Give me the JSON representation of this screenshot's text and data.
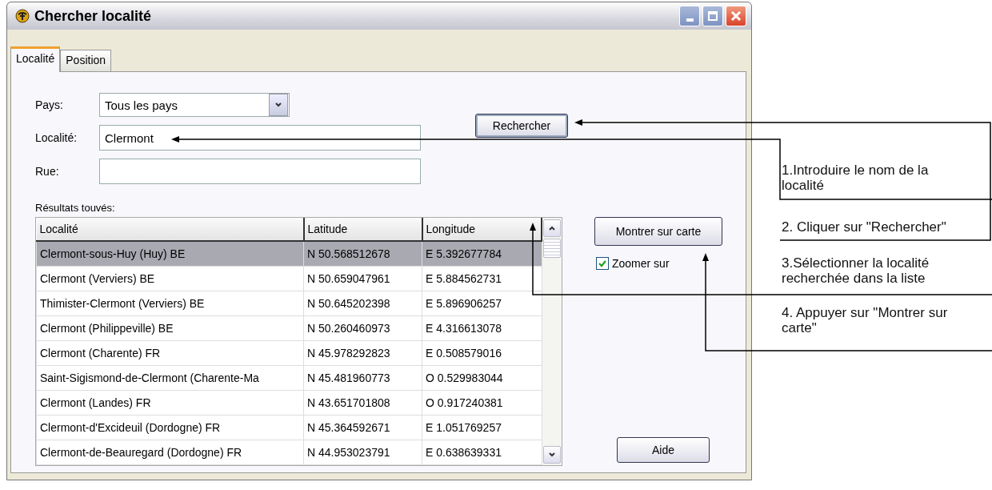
{
  "window": {
    "title": "Chercher localité"
  },
  "tabs": [
    {
      "label": "Localité",
      "selected": true
    },
    {
      "label": "Position",
      "selected": false
    }
  ],
  "form": {
    "country_label": "Pays:",
    "country_value": "Tous les pays",
    "locality_label": "Localité:",
    "locality_value": "Clermont",
    "street_label": "Rue:",
    "search_button": "Rechercher"
  },
  "results_label": "Résultats touvés:",
  "table": {
    "columns": [
      "Localité",
      "Latitude",
      "Longitude"
    ],
    "rows": [
      {
        "cells": [
          "Clermont-sous-Huy (Huy) BE",
          "N 50.568512678",
          "E 5.392677784"
        ],
        "selected": true
      },
      {
        "cells": [
          "Clermont (Verviers) BE",
          "N 50.659047961",
          "E 5.884562731"
        ],
        "selected": false
      },
      {
        "cells": [
          "Thimister-Clermont (Verviers) BE",
          "N 50.645202398",
          "E 5.896906257"
        ],
        "selected": false
      },
      {
        "cells": [
          "Clermont (Philippeville) BE",
          "N 50.260460973",
          "E 4.316613078"
        ],
        "selected": false
      },
      {
        "cells": [
          "Clermont (Charente) FR",
          "N 45.978292823",
          "E 0.508579016"
        ],
        "selected": false
      },
      {
        "cells": [
          "Saint-Sigismond-de-Clermont (Charente-Ma",
          "N 45.481960773",
          "O 0.529983044"
        ],
        "selected": false
      },
      {
        "cells": [
          "Clermont (Landes) FR",
          "N 43.651701808",
          "O 0.917240381"
        ],
        "selected": false
      },
      {
        "cells": [
          "Clermont-d'Excideuil (Dordogne) FR",
          "N 45.364592671",
          "E 1.051769257"
        ],
        "selected": false
      },
      {
        "cells": [
          "Clermont-de-Beauregard (Dordogne) FR",
          "N 44.953023791",
          "E 0.638639331"
        ],
        "selected": false
      }
    ]
  },
  "show_button": "Montrer sur carte",
  "zoom_checkbox": {
    "label": "Zoomer sur",
    "checked": true
  },
  "help_button": "Aide",
  "annotations": [
    "1.Introduire le nom de la localité",
    "2. Cliquer sur \"Rechercher\"",
    "3.Sélectionner la localité recherchée dans la liste",
    "4. Appuyer sur \"Montrer sur carte\""
  ]
}
